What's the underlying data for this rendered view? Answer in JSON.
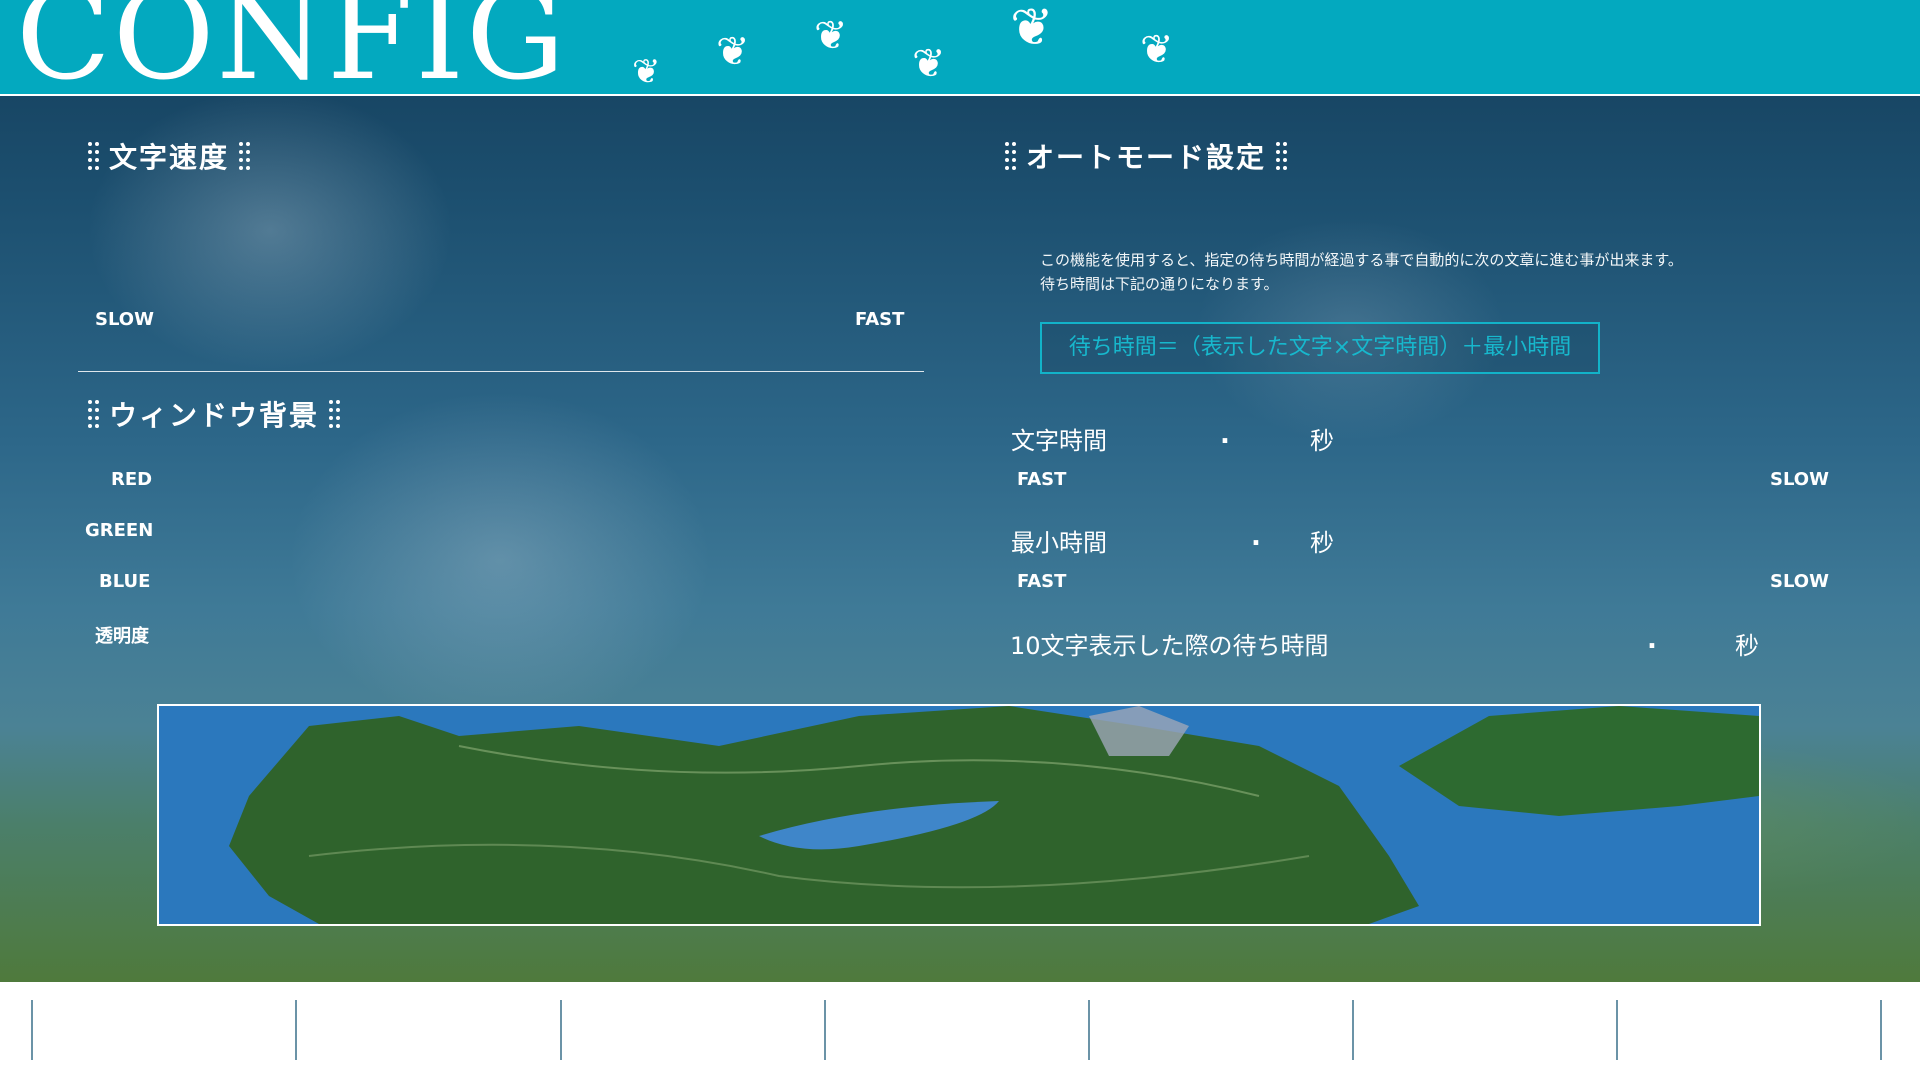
{
  "header": {
    "title": "CONFIG",
    "colors": {
      "bar": "#03a9bf",
      "accent": "#17b8cd"
    }
  },
  "text_speed": {
    "title": "文字速度",
    "left_label": "SLOW",
    "right_label": "FAST"
  },
  "window_bg": {
    "title": "ウィンドウ背景",
    "labels": [
      "RED",
      "GREEN",
      "BLUE",
      "透明度"
    ]
  },
  "auto_mode": {
    "title": "オートモード設定",
    "description": [
      "この機能を使用すると、指定の待ち時間が経過する事で自動的に次の文章に進む事が出来ます。",
      "待ち時間は下記の通りになります。"
    ],
    "formula": "待ち時間＝（表示した文字×文字時間）＋最小時間",
    "char_time": {
      "label": "文字時間",
      "separator": ".",
      "unit": "秒",
      "left": "FAST",
      "right": "SLOW"
    },
    "min_time": {
      "label": "最小時間",
      "separator": ".",
      "unit": "秒",
      "left": "FAST",
      "right": "SLOW"
    },
    "ten_char": {
      "label": "10文字表示した際の待ち時間",
      "separator": ".",
      "unit": "秒"
    }
  },
  "footer": {
    "slot_count": 8
  }
}
